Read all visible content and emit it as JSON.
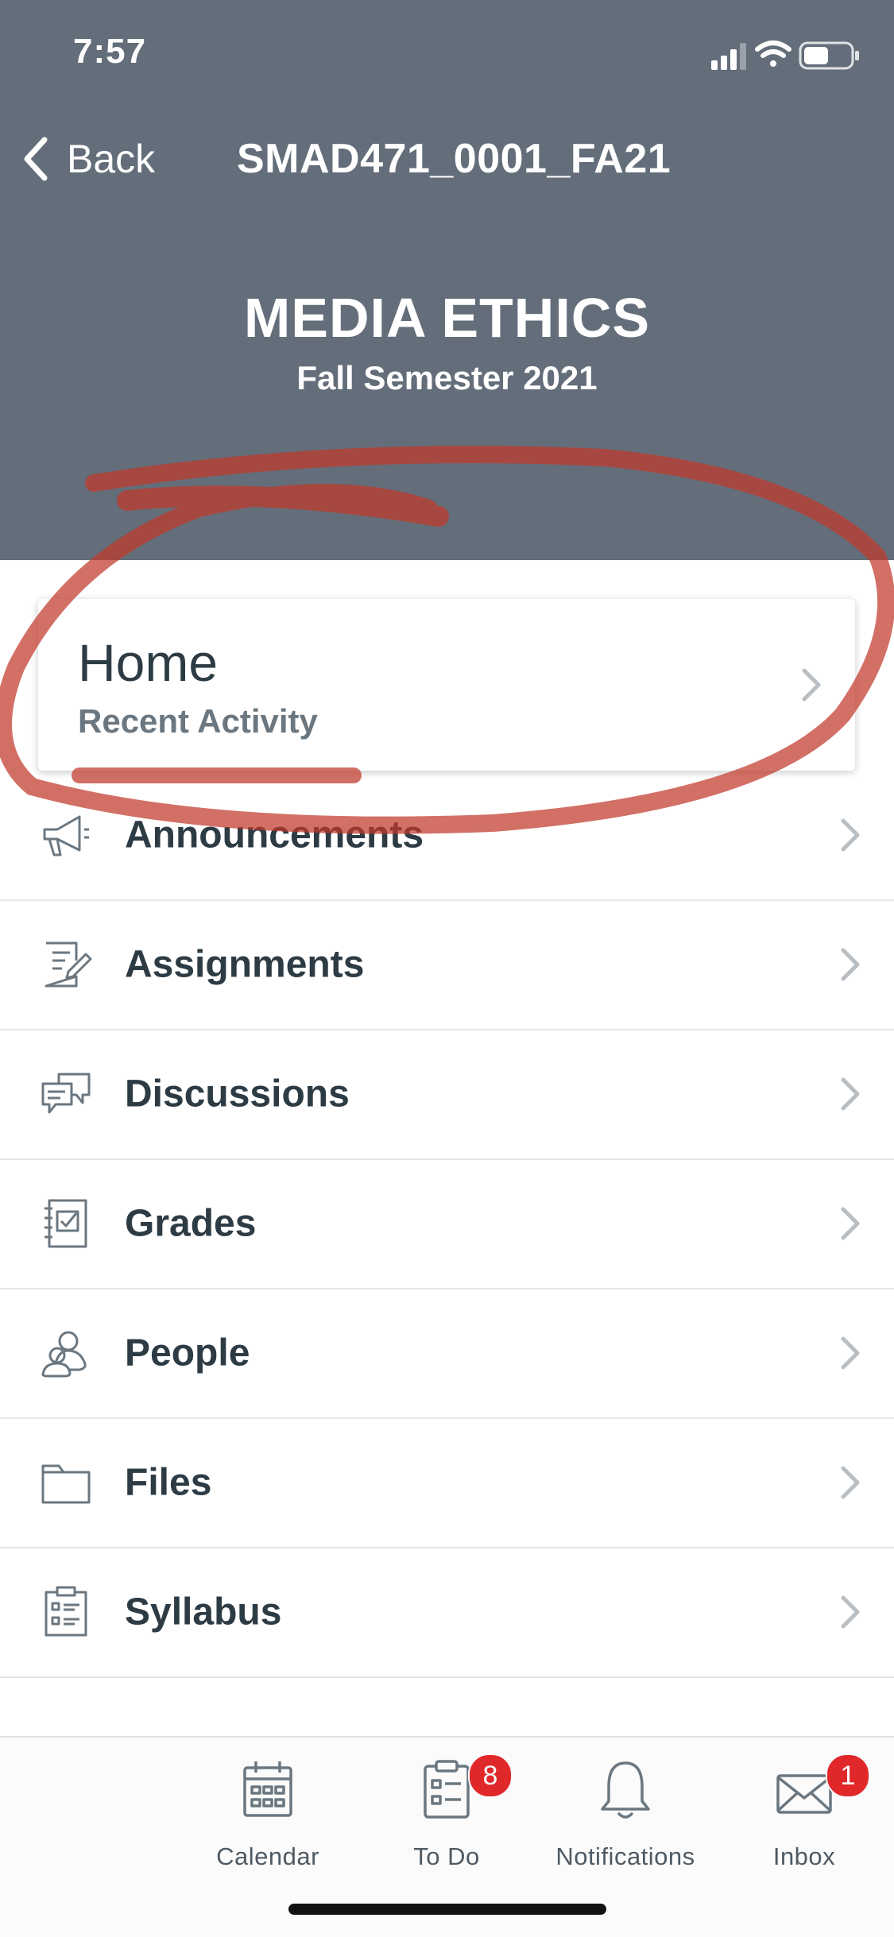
{
  "status_bar": {
    "time": "7:57"
  },
  "nav": {
    "back_label": "Back",
    "course_code": "SMAD471_0001_FA21"
  },
  "course": {
    "title": "MEDIA ETHICS",
    "term": "Fall Semester 2021"
  },
  "home_card": {
    "title": "Home",
    "subtitle": "Recent Activity"
  },
  "menu": {
    "items": [
      {
        "label": "Announcements",
        "icon": "megaphone-icon"
      },
      {
        "label": "Assignments",
        "icon": "assignment-icon"
      },
      {
        "label": "Discussions",
        "icon": "discussion-icon"
      },
      {
        "label": "Grades",
        "icon": "gradebook-icon"
      },
      {
        "label": "People",
        "icon": "people-icon"
      },
      {
        "label": "Files",
        "icon": "folder-icon"
      },
      {
        "label": "Syllabus",
        "icon": "syllabus-icon"
      }
    ]
  },
  "tab_bar": {
    "tabs": [
      {
        "label": "Calendar",
        "icon": "calendar-icon",
        "badge": ""
      },
      {
        "label": "To Do",
        "icon": "todo-icon",
        "badge": "8"
      },
      {
        "label": "Notifications",
        "icon": "bell-icon",
        "badge": ""
      },
      {
        "label": "Inbox",
        "icon": "mail-icon",
        "badge": "1"
      }
    ]
  },
  "colors": {
    "header_bg": "#646e7a",
    "text_primary": "#2d3b45",
    "badge": "#e0282a",
    "annotation": "#c0392b"
  }
}
